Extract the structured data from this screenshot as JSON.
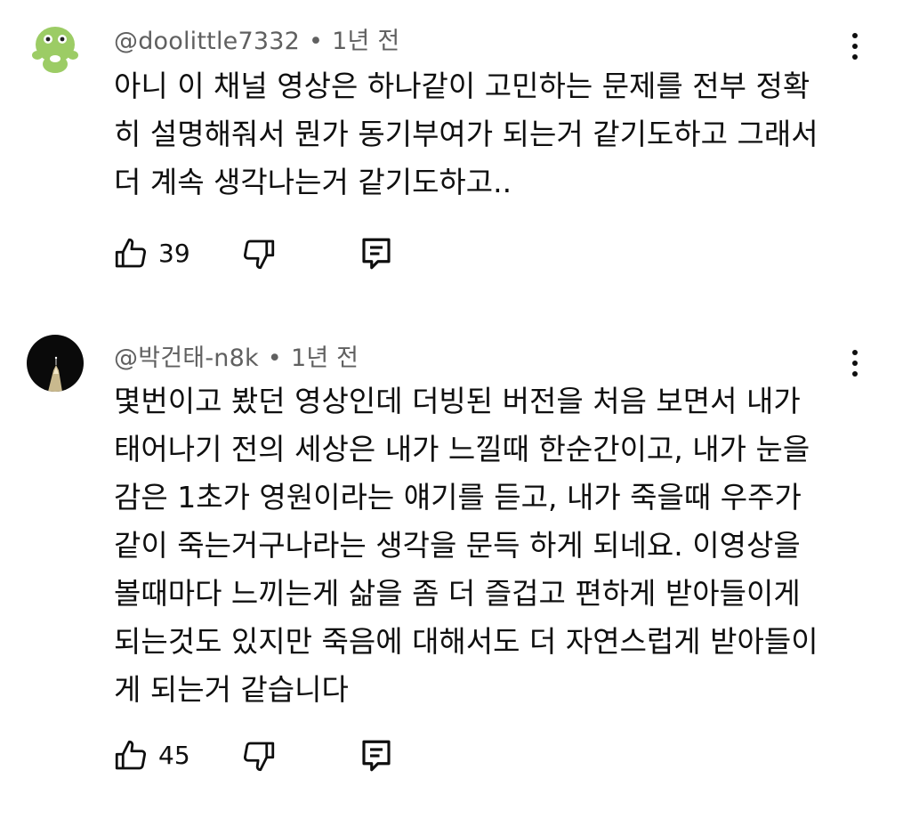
{
  "comments": [
    {
      "handle": "@doolittle7332",
      "separator": "•",
      "time": "1년 전",
      "text": "아니 이 채널 영상은 하나같이 고민하는 문제를 전부 정확\n히 설명해줘서 뭔가 동기부여가 되는거 같기도하고 그래서\n더 계속 생각나는거 같기도하고..",
      "likes": "39",
      "avatar_color": "#9ccc65"
    },
    {
      "handle": "@박건태-n8k",
      "separator": "•",
      "time": "1년 전",
      "text": "몇번이고 봤던 영상인데 더빙된 버전을 처음 보면서 내가\n태어나기 전의 세상은 내가 느낄때 한순간이고, 내가 눈을\n감은 1초가 영원이라는 얘기를 듣고, 내가 죽을때 우주가\n같이 죽는거구나라는 생각을 문득 하게 되네요. 이영상을\n볼때마다 느끼는게 삶을 좀 더 즐겁고 편하게 받아들이게\n되는것도 있지만 죽음에 대해서도 더 자연스럽게 받아들이\n게 되는거 같습니다",
      "likes": "45",
      "avatar_color": "#0a0a0a"
    }
  ]
}
